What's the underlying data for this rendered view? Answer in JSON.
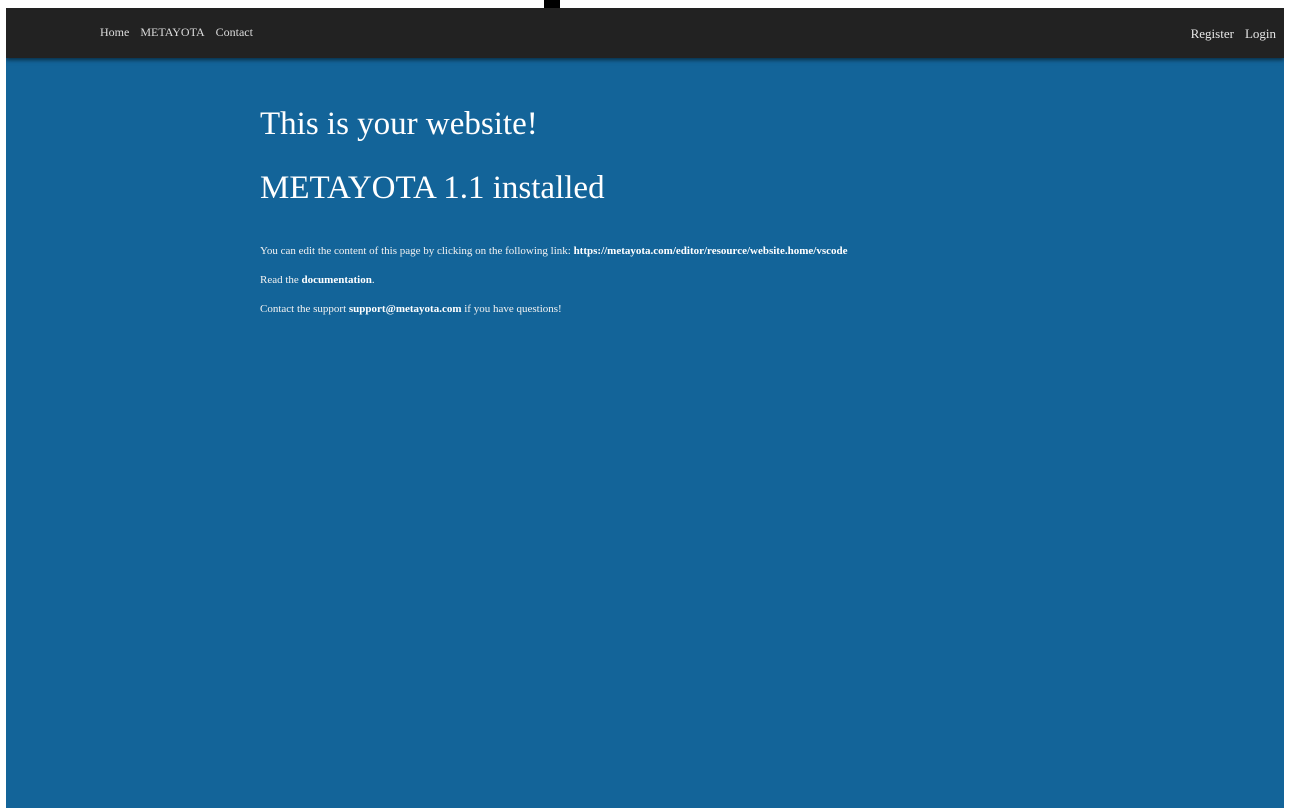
{
  "nav": {
    "left": [
      "Home",
      "METAYOTA",
      "Contact"
    ],
    "right": [
      "Register",
      "Login"
    ]
  },
  "main": {
    "title": "This is your website!",
    "subtitle": "METAYOTA 1.1 installed",
    "edit_text_before": "You can edit the content of this page by clicking on the following link: ",
    "edit_link": "https://metayota.com/editor/resource/website.home/vscode",
    "docs_text_before": "Read the ",
    "docs_link": "documentation",
    "docs_text_after": ".",
    "support_text_before": "Contact the support ",
    "support_link": "support@metayota.com",
    "support_text_after": " if you have questions!"
  },
  "colors": {
    "navbar": "#222222",
    "background": "#136499",
    "text": "#ffffff"
  }
}
